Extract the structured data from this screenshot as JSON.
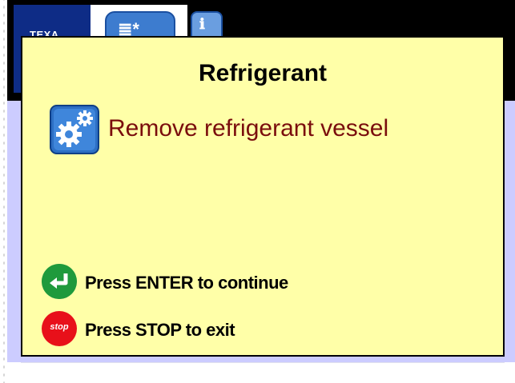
{
  "header": {
    "brand_logo_text": "TEXA",
    "tabs": [
      {
        "icon": "refrigerant-gas-icon"
      },
      {
        "icon": "info-icon"
      }
    ]
  },
  "dialog": {
    "title": "Refrigerant",
    "icon": "gears-icon",
    "message": "Remove refrigerant vessel",
    "actions": [
      {
        "icon": "enter-icon",
        "label": "Press ENTER to continue"
      },
      {
        "icon": "stop-icon",
        "icon_text": "stop",
        "label": "Press STOP to exit"
      }
    ]
  },
  "colors": {
    "dialog_background": "#ffffa8",
    "message_text": "#7a0d0d",
    "background": "#ccccff",
    "header_bar": "#000000",
    "brand_blue": "#0e2c86",
    "enter_green": "#1f9a3c",
    "stop_red": "#e8101a"
  }
}
